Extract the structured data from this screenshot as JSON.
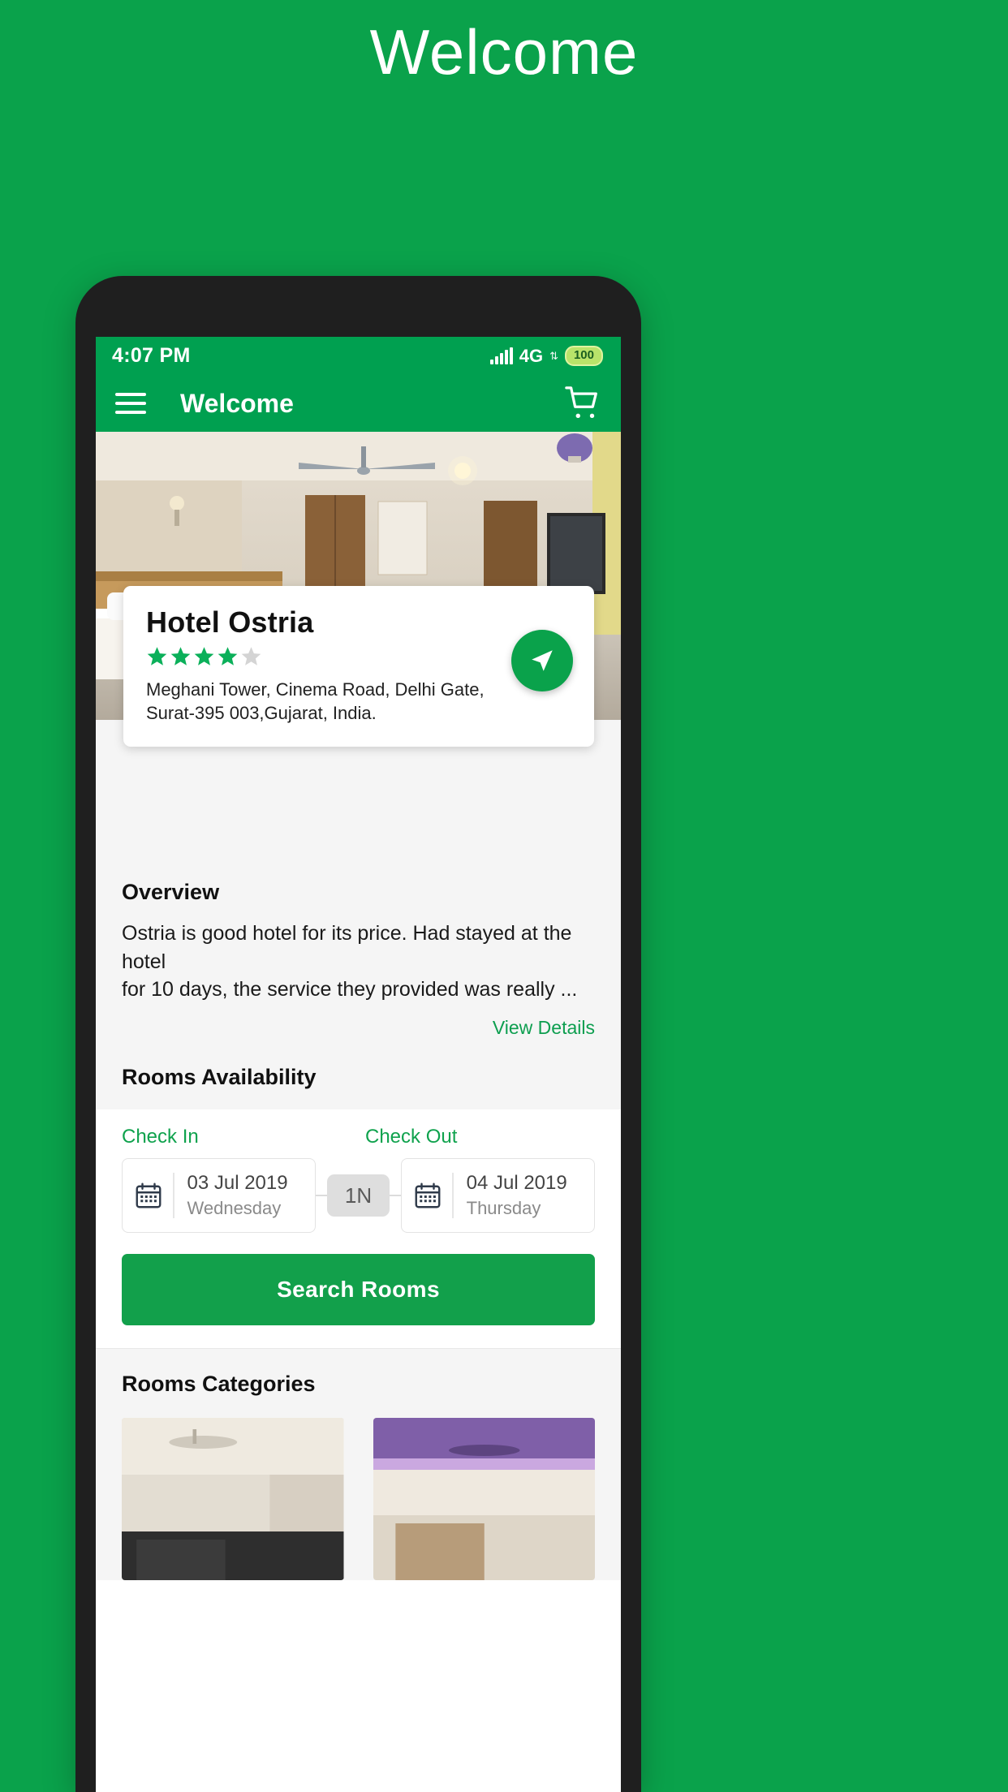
{
  "promo": {
    "title": "Welcome"
  },
  "status_bar": {
    "time": "4:07 PM",
    "network": "4G",
    "network_arrows": "⇅",
    "battery": "100",
    "signal_icon": "signal-bars-icon"
  },
  "app_bar": {
    "menu_icon": "hamburger-menu-icon",
    "title": "Welcome",
    "cart_icon": "shopping-cart-icon"
  },
  "hotel_card": {
    "name": "Hotel Ostria",
    "rating_filled": 4,
    "rating_total": 5,
    "star_filled_color": "#0bb05a",
    "star_empty_color": "#d4d4d4",
    "address_line1": "Meghani Tower, Cinema Road, Delhi Gate,",
    "address_line2": "Surat-395 003,Gujarat, India.",
    "navigate_icon": "navigation-arrow-icon"
  },
  "overview": {
    "heading": "Overview",
    "text_line1": "Ostria is good hotel for its price. Had stayed at the hotel",
    "text_line2": "for 10 days, the service they provided was really ...",
    "view_details_label": "View Details"
  },
  "rooms_availability": {
    "heading": "Rooms Availability",
    "check_in_label": "Check In",
    "check_out_label": "Check Out",
    "check_in_date": "03 Jul 2019",
    "check_in_day": "Wednesday",
    "check_out_date": "04 Jul 2019",
    "check_out_day": "Thursday",
    "nights_badge": "1N",
    "calendar_icon": "calendar-icon",
    "search_button_label": "Search Rooms"
  },
  "rooms_categories": {
    "heading": "Rooms Categories"
  },
  "colors": {
    "brand_green": "#0aa24b",
    "appbar_green": "#00a050",
    "link_green": "#0d9e4f",
    "page_bg": "#f5f5f5"
  }
}
